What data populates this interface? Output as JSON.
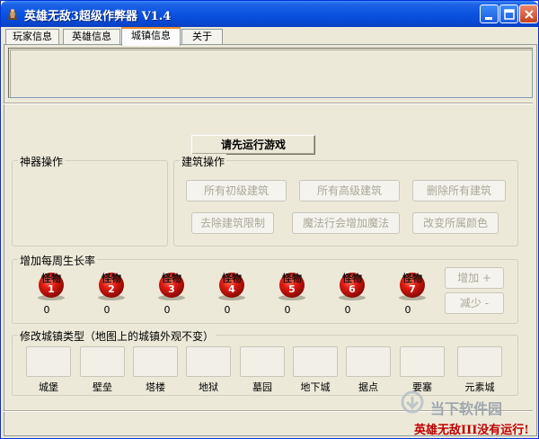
{
  "window": {
    "title": "英雄无敌3超级作弊器 V1.4"
  },
  "tabs": [
    {
      "label": "玩家信息"
    },
    {
      "label": "英雄信息"
    },
    {
      "label": "城镇信息",
      "active": true
    },
    {
      "label": "关于"
    }
  ],
  "status_button": "请先运行游戏",
  "artifact_group": {
    "title": "神器操作"
  },
  "building_group": {
    "title": "建筑操作",
    "buttons": [
      "所有初级建筑",
      "所有高级建筑",
      "删除所有建筑",
      "去除建筑限制",
      "魔法行会增加魔法",
      "改变所属颜色"
    ]
  },
  "growth_group": {
    "title": "增加每周生长率",
    "orb_label": "怪物",
    "monsters": [
      {
        "num": "1",
        "count": "0"
      },
      {
        "num": "2",
        "count": "0"
      },
      {
        "num": "3",
        "count": "0"
      },
      {
        "num": "4",
        "count": "0"
      },
      {
        "num": "5",
        "count": "0"
      },
      {
        "num": "6",
        "count": "0"
      },
      {
        "num": "7",
        "count": "0"
      }
    ],
    "add_button": "增加 +",
    "sub_button": "减少 -"
  },
  "town_group": {
    "title": "修改城镇类型（地图上的城镇外观不变）",
    "towns": [
      "城堡",
      "壁垒",
      "塔楼",
      "地狱",
      "墓园",
      "地下城",
      "据点",
      "要塞",
      "元素城"
    ]
  },
  "watermark": "当下软件园",
  "status_message": "英雄无敌III没有运行!",
  "colors": {
    "title_bar": "#0A53E0",
    "orb_red": "#E01810",
    "status_red": "#C00000",
    "disabled_text": "#ACA899"
  }
}
